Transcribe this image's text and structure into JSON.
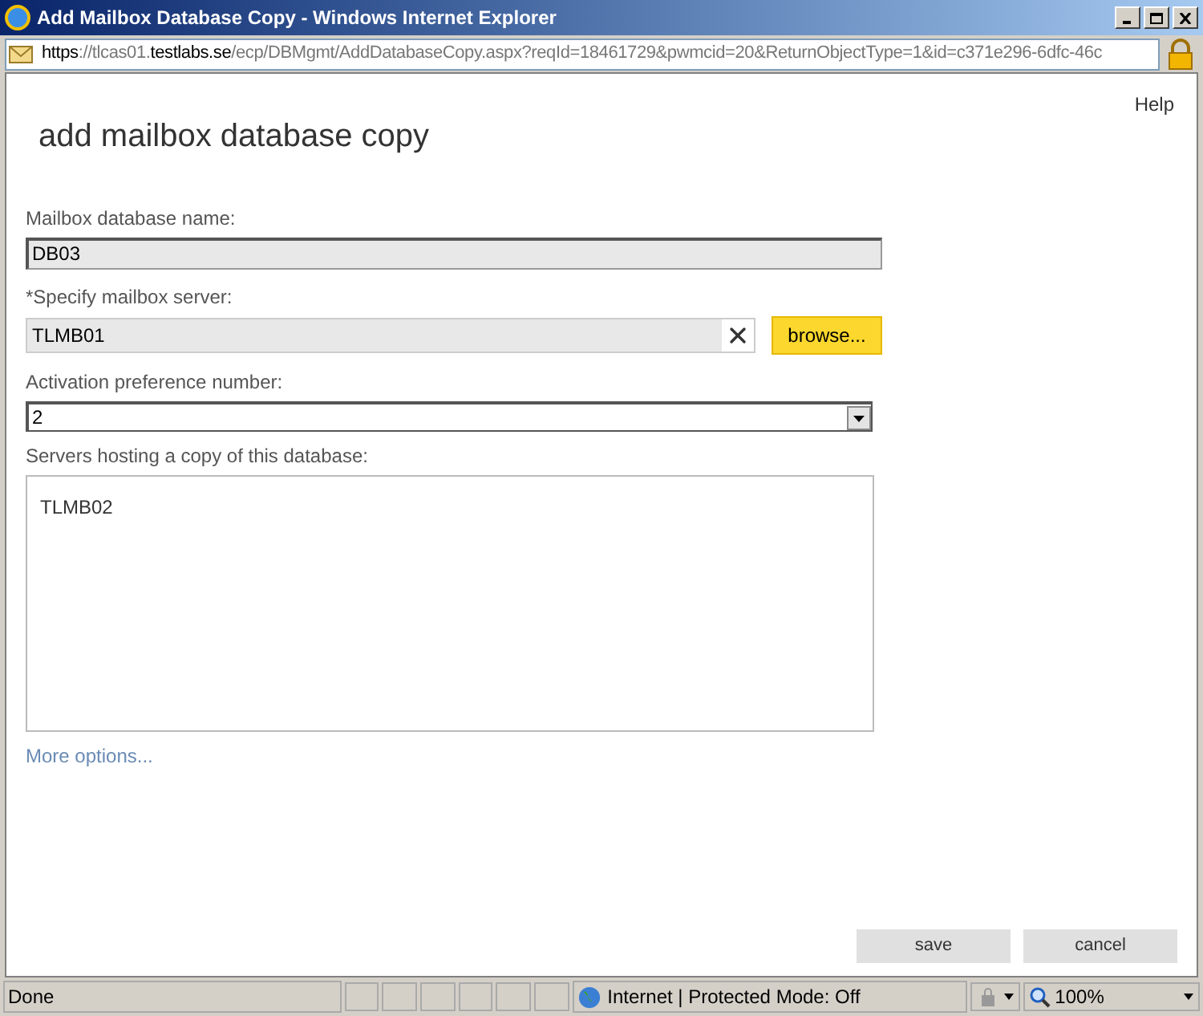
{
  "window": {
    "title": "Add Mailbox Database Copy - Windows Internet Explorer"
  },
  "address_bar": {
    "url_parts": [
      {
        "text": "https",
        "emphasis": true
      },
      {
        "text": "://tlcas01.",
        "emphasis": false
      },
      {
        "text": "testlabs.se",
        "emphasis": true
      },
      {
        "text": "/ecp/DBMgmt/AddDatabaseCopy.aspx?reqId=18461729&pwmcid=20&ReturnObjectType=1&id=c371e296-6dfc-46c",
        "emphasis": false
      }
    ]
  },
  "page": {
    "help": "Help",
    "heading": "add mailbox database copy",
    "fields": [
      {
        "label": "Mailbox database name:",
        "value": "DB03",
        "kind": "readonly"
      },
      {
        "label": "*Specify mailbox server:",
        "value": "TLMB01",
        "kind": "picker",
        "button": "browse..."
      },
      {
        "label": "Activation preference number:",
        "value": "2",
        "kind": "dropdown"
      }
    ],
    "servers": {
      "label": "Servers hosting a copy of this database:",
      "items": [
        "TLMB02"
      ]
    },
    "more_options": "More options...",
    "buttons": [
      "save",
      "cancel"
    ]
  },
  "status_bar": {
    "text": "Done",
    "zone": "Internet | Protected Mode: Off",
    "zoom": "100%"
  }
}
